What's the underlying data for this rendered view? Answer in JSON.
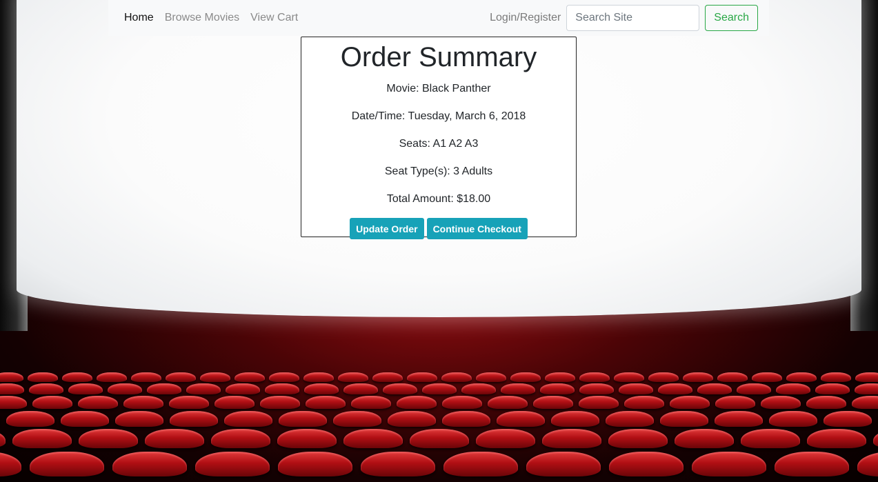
{
  "navbar": {
    "links": [
      "Home",
      "Browse Movies",
      "View Cart"
    ],
    "login": "Login/Register",
    "search_placeholder": "Search Site",
    "search_button": "Search"
  },
  "order": {
    "title": "Order Summary",
    "movie": "Movie: Black Panther",
    "datetime": "Date/Time: Tuesday, March 6, 2018",
    "seats": "Seats: A1 A2 A3",
    "seat_types": "Seat Type(s): 3 Adults",
    "total": "Total Amount: $18.00",
    "update_button": "Update Order",
    "checkout_button": "Continue Checkout"
  },
  "colors": {
    "navbar_bg": "#f8f9fa",
    "success": "#28a745",
    "info": "#17a2b8"
  }
}
